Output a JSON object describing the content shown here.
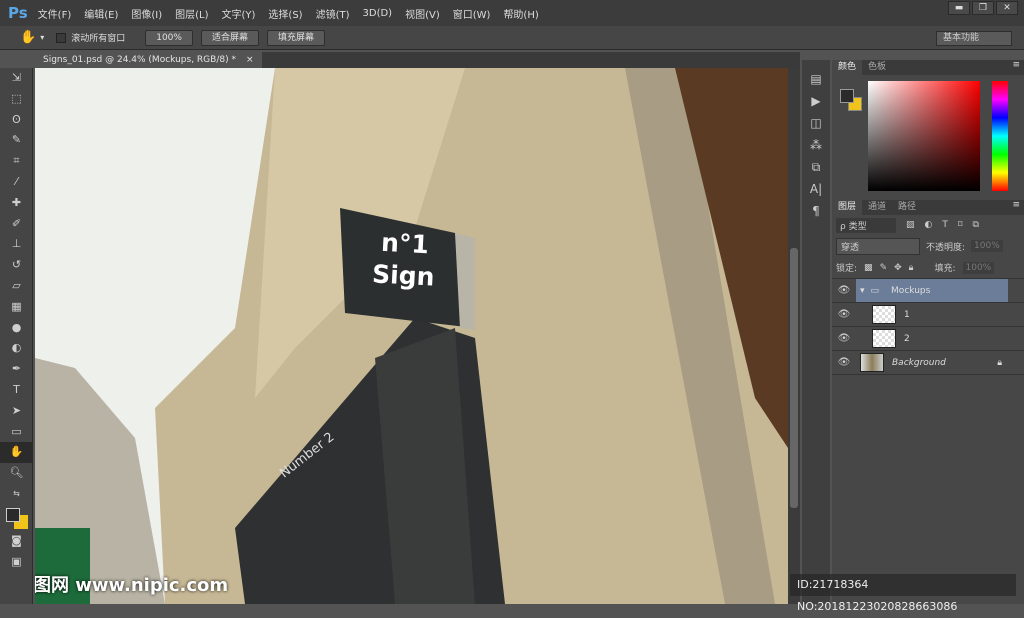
{
  "app": {
    "logo": "Ps"
  },
  "menu": [
    "文件(F)",
    "编辑(E)",
    "图像(I)",
    "图层(L)",
    "文字(Y)",
    "选择(S)",
    "滤镜(T)",
    "3D(D)",
    "视图(V)",
    "窗口(W)",
    "帮助(H)"
  ],
  "window_buttons": [
    "▬",
    "❐",
    "✕"
  ],
  "options": {
    "scroll_all": "滚动所有窗口",
    "zoom100": "100%",
    "fit_screen": "适合屏幕",
    "fill_screen": "填充屏幕",
    "workspace": "基本功能"
  },
  "document_tab": {
    "title": "Signs_01.psd @ 24.4% (Mockups, RGB/8) *",
    "close": "×"
  },
  "canvas": {
    "sign_line1": "n°1",
    "sign_line2": "Sign",
    "storefront": "Number 2"
  },
  "color_panel": {
    "tabs": [
      "颜色",
      "色板"
    ],
    "foreground": "#2a2a2a",
    "background": "#f0c419"
  },
  "layers_panel": {
    "tabs": [
      "图层",
      "通道",
      "路径"
    ],
    "filter_kind": "ρ 类型",
    "blend_mode": "穿透",
    "opacity_label": "不透明度:",
    "opacity": "100%",
    "lock_label": "锁定:",
    "fill_label": "填充:",
    "fill": "100%",
    "layers": [
      {
        "name": "Mockups",
        "type": "group"
      },
      {
        "name": "1",
        "type": "smart"
      },
      {
        "name": "2",
        "type": "smart"
      },
      {
        "name": "Background",
        "type": "background"
      }
    ]
  },
  "watermark": {
    "site": "昵图网 www.nipic.com",
    "id": "ID:21718364 NO:20181223020828663086"
  }
}
